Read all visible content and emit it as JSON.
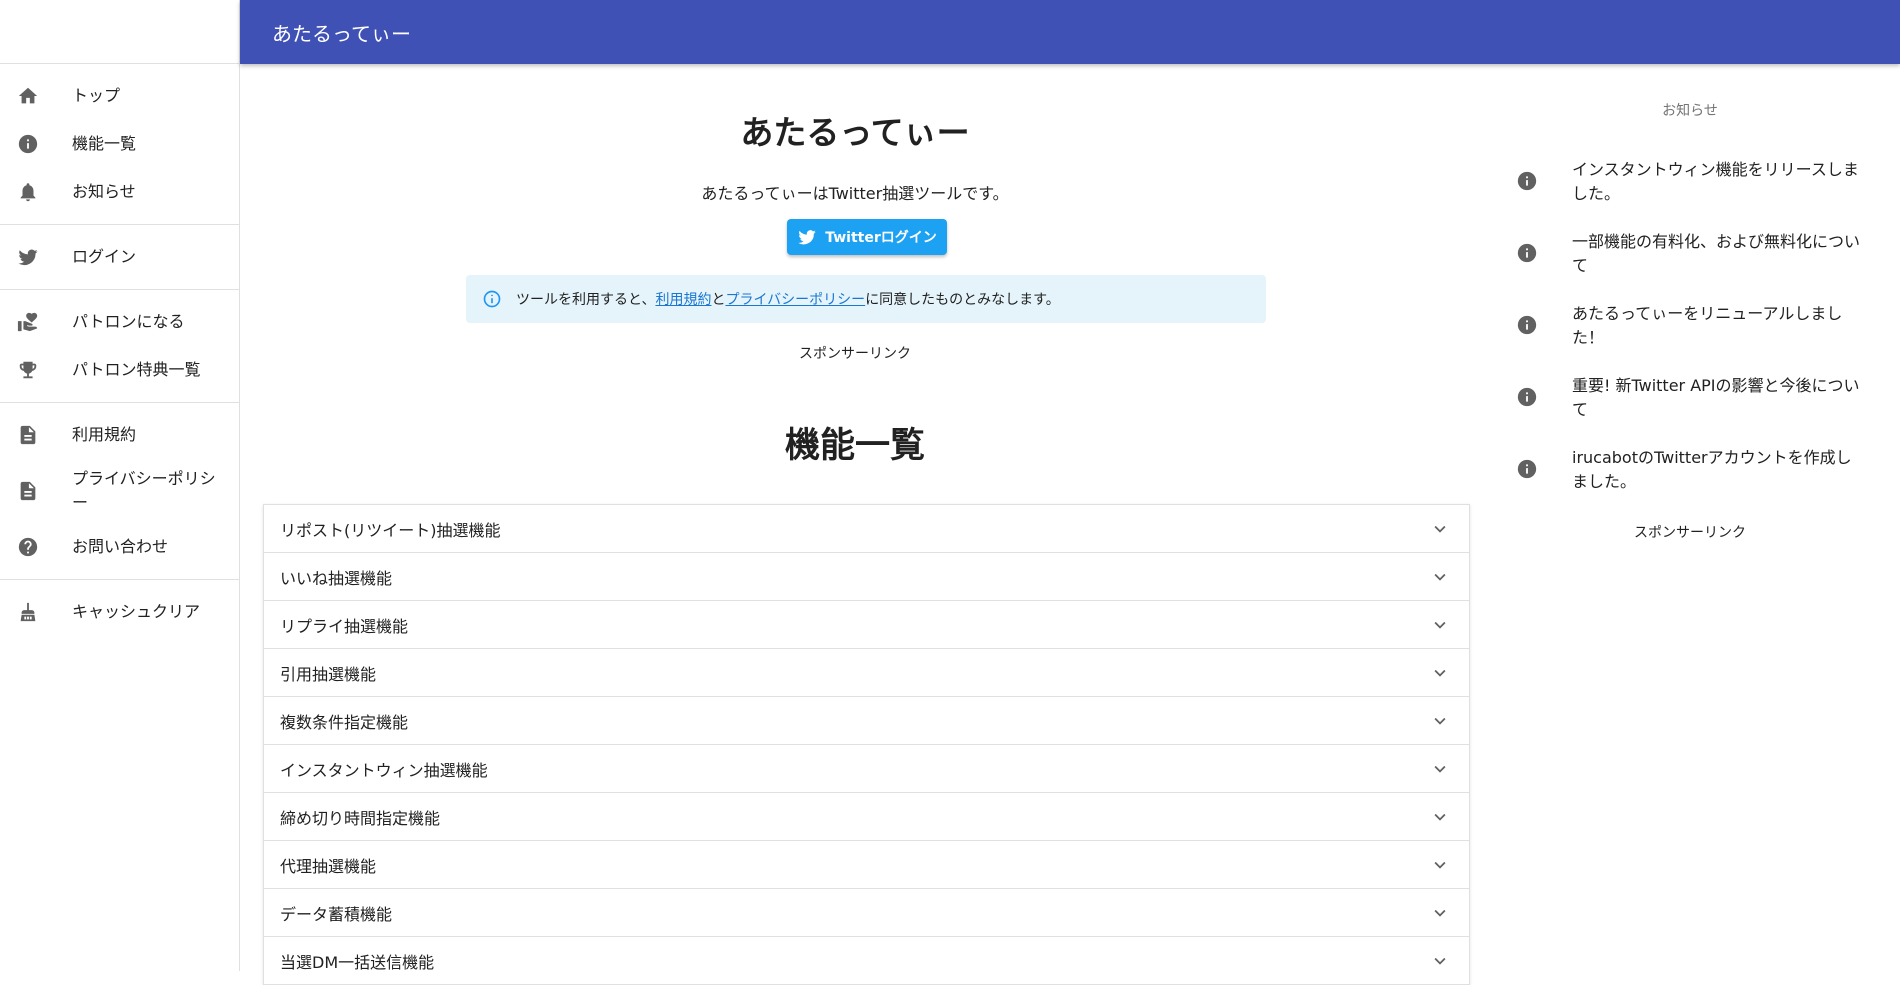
{
  "app": {
    "title": "あたるってぃー"
  },
  "sidebar": {
    "groups": [
      {
        "items": [
          {
            "label": "トップ",
            "icon": "home-icon"
          },
          {
            "label": "機能一覧",
            "icon": "info-icon"
          },
          {
            "label": "お知らせ",
            "icon": "bell-icon"
          }
        ]
      },
      {
        "items": [
          {
            "label": "ログイン",
            "icon": "twitter-icon"
          }
        ]
      },
      {
        "items": [
          {
            "label": "パトロンになる",
            "icon": "hand-heart-icon"
          },
          {
            "label": "パトロン特典一覧",
            "icon": "trophy-icon"
          }
        ]
      },
      {
        "items": [
          {
            "label": "利用規約",
            "icon": "document-icon"
          },
          {
            "label": "プライバシーポリシー",
            "icon": "document-icon"
          },
          {
            "label": "お問い合わせ",
            "icon": "help-circle-icon"
          }
        ]
      },
      {
        "items": [
          {
            "label": "キャッシュクリア",
            "icon": "broom-icon"
          }
        ]
      }
    ]
  },
  "main": {
    "hero_title": "あたるってぃー",
    "hero_description": "あたるってぃーはTwitter抽選ツールです。",
    "login_button": "Twitterログイン",
    "notice": {
      "prefix": "ツールを利用すると、",
      "terms_link": "利用規約",
      "and": "と",
      "privacy_link": "プライバシーポリシー",
      "suffix": "に同意したものとみなします。"
    },
    "sponsor_label": "スポンサーリンク",
    "features_title": "機能一覧",
    "features": [
      "リポスト(リツイート)抽選機能",
      "いいね抽選機能",
      "リプライ抽選機能",
      "引用抽選機能",
      "複数条件指定機能",
      "インスタントウィン抽選機能",
      "締め切り時間指定機能",
      "代理抽選機能",
      "データ蓄積機能",
      "当選DM一括送信機能"
    ]
  },
  "news": {
    "heading": "お知らせ",
    "items": [
      "インスタントウィン機能をリリースしました。",
      "一部機能の有料化、および無料化について",
      "あたるってぃーをリニューアルしました！",
      "重要! 新Twitter APIの影響と今後について",
      "irucabotのTwitterアカウントを作成しました。"
    ],
    "sponsor_label": "スポンサーリンク"
  },
  "colors": {
    "appbar": "#3f51b5",
    "twitter": "#1da1f2",
    "notice_bg": "#e5f4fb",
    "link": "#1976d2"
  }
}
